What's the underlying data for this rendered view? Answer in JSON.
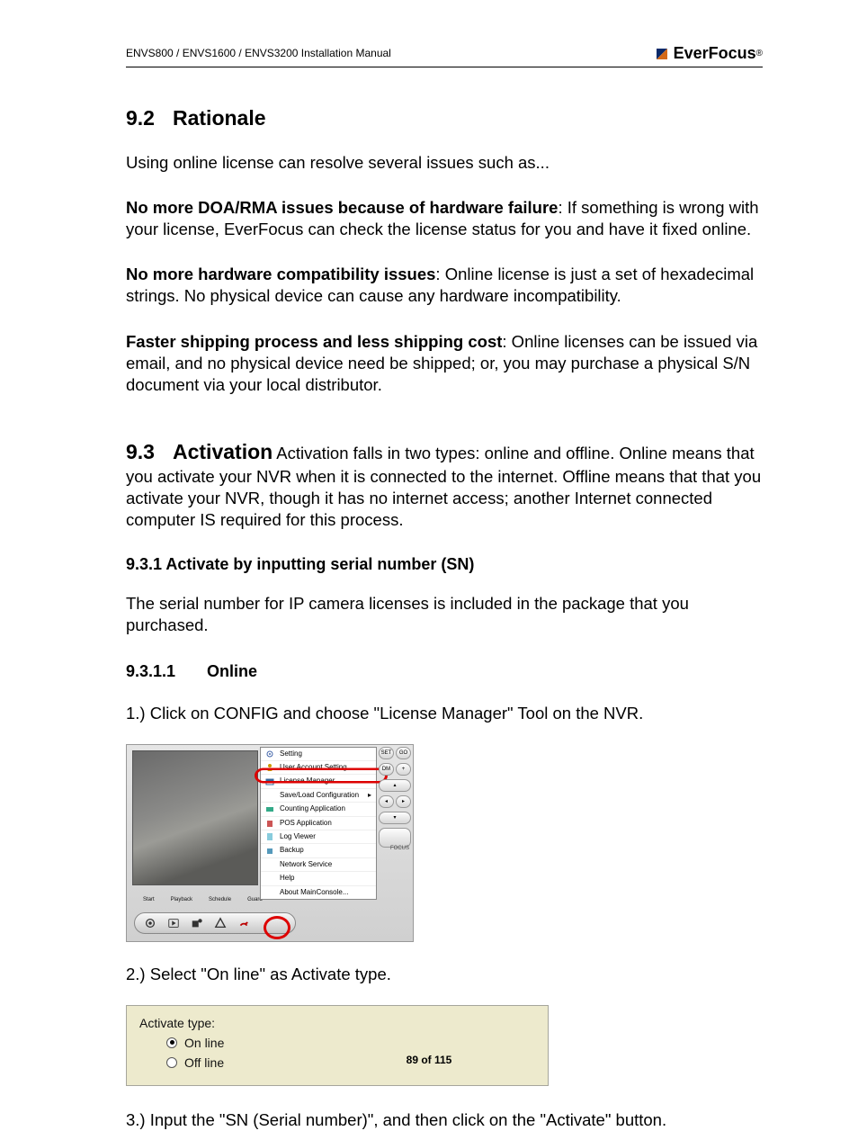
{
  "header": {
    "left": "ENVS800 / ENVS1600 / ENVS3200 Installation Manual",
    "brand": "EverFocus"
  },
  "sec92": {
    "num": "9.2",
    "title": "Rationale",
    "intro": "Using online license can resolve several issues such as...",
    "p1_bold": "No more DOA/RMA issues because of hardware failure",
    "p1_rest": ": If something is wrong with your license, EverFocus can check the license status for you and have it fixed online.",
    "p2_bold": "No more hardware compatibility issues",
    "p2_rest": ": Online license is just a set of hexadecimal strings. No physical device can cause any hardware incompatibility.",
    "p3_bold": "Faster shipping process and less shipping cost",
    "p3_rest": ": Online licenses can be issued via email, and no physical device need be shipped; or, you may purchase a physical S/N document via your local distributor."
  },
  "sec93": {
    "num": "9.3",
    "title": "Activation",
    "intro": " Activation falls in two types: online and offline. Online means that you activate your NVR when it is connected to the internet. Offline means that that you activate your NVR, though it has no internet access; another Internet connected computer IS required for this process.",
    "sub931": "9.3.1 Activate by inputting serial number (SN)",
    "sub931_text": "The serial number for IP camera licenses is included in the package that you purchased.",
    "sub9311_num": "9.3.1.1",
    "sub9311_title": "Online",
    "step1": "1.) Click on CONFIG and choose \"License Manager\" Tool on the NVR.",
    "step2": "2.) Select \"On line\" as Activate type.",
    "step3": "3.) Input the \"SN (Serial number)\", and then click on the \"Activate\" button."
  },
  "shot1": {
    "bottom_tabs": [
      "Start",
      "Playback",
      "Schedule",
      "Guard"
    ],
    "menu": [
      "Setting",
      "User Account Setting",
      "License Manager",
      "Save/Load Configuration",
      "Counting Application",
      "POS Application",
      "Log Viewer",
      "Backup",
      "Network Service",
      "Help",
      "About MainConsole..."
    ],
    "right_top": [
      "SET",
      "GO",
      "DM",
      "+"
    ],
    "focus": "FOCUS"
  },
  "shot2": {
    "label": "Activate type:",
    "opt1": "On line",
    "opt2": "Off line",
    "selected": "On line"
  },
  "footer": "89 of 115"
}
